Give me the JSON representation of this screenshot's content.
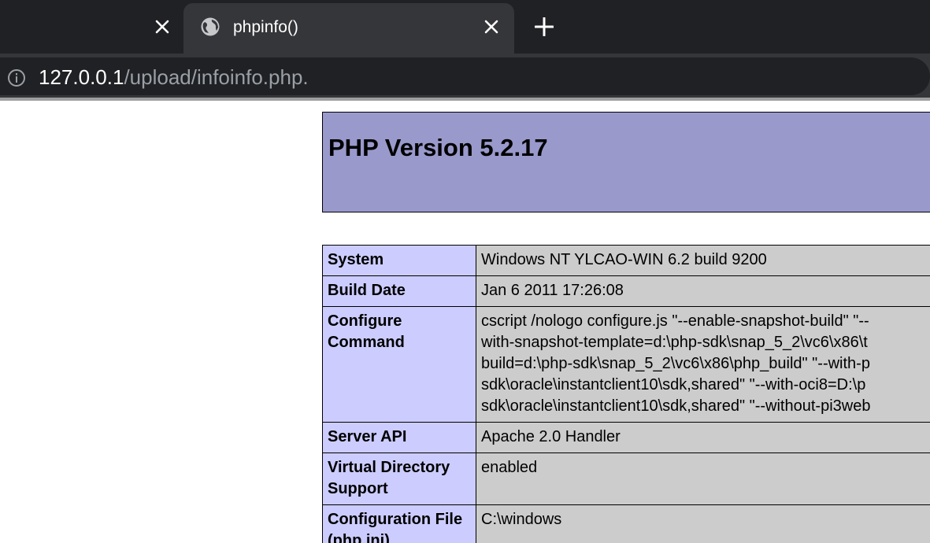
{
  "browser": {
    "tab_title": "phpinfo()",
    "url_host": "127.0.0.1",
    "url_path": "/upload/infoinfo.php."
  },
  "page": {
    "title": "PHP Version 5.2.17",
    "rows": [
      {
        "key": "System",
        "value": "Windows NT YLCAO-WIN 6.2 build 9200"
      },
      {
        "key": "Build Date",
        "value": "Jan 6 2011 17:26:08"
      },
      {
        "key": "Configure Command",
        "value_lines": [
          "cscript /nologo configure.js \"--enable-snapshot-build\" \"--",
          "with-snapshot-template=d:\\php-sdk\\snap_5_2\\vc6\\x86\\t",
          "build=d:\\php-sdk\\snap_5_2\\vc6\\x86\\php_build\" \"--with-p",
          "sdk\\oracle\\instantclient10\\sdk,shared\" \"--with-oci8=D:\\p",
          "sdk\\oracle\\instantclient10\\sdk,shared\" \"--without-pi3web"
        ]
      },
      {
        "key": "Server API",
        "value": "Apache 2.0 Handler"
      },
      {
        "key": "Virtual Directory Support",
        "value": "enabled"
      },
      {
        "key": "Configuration File (php.ini)",
        "value": "C:\\windows"
      }
    ]
  }
}
